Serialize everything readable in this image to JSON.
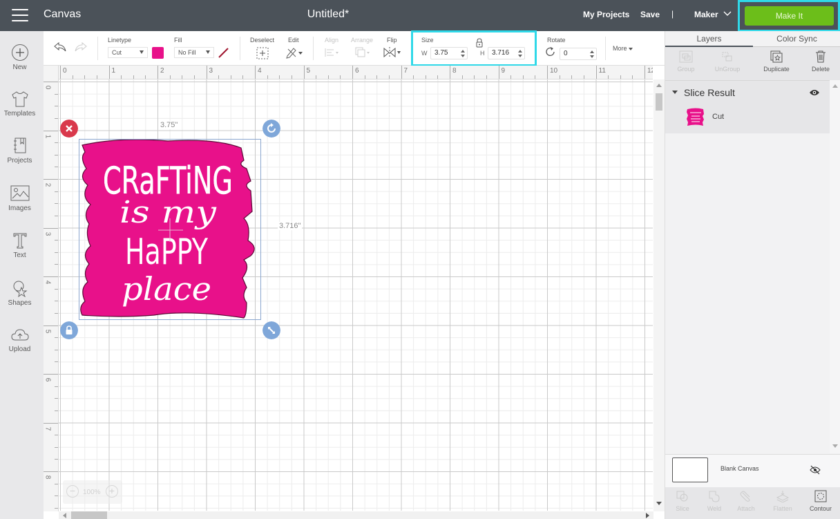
{
  "header": {
    "app_title": "Canvas",
    "document_title": "Untitled*",
    "my_projects": "My Projects",
    "save": "Save",
    "separator": "|",
    "machine": "Maker",
    "make_it": "Make It"
  },
  "sidebar": {
    "items": [
      {
        "label": "New",
        "icon": "plus-circle-icon"
      },
      {
        "label": "Templates",
        "icon": "tshirt-icon"
      },
      {
        "label": "Projects",
        "icon": "notebook-icon"
      },
      {
        "label": "Images",
        "icon": "image-icon"
      },
      {
        "label": "Text",
        "icon": "text-t-icon"
      },
      {
        "label": "Shapes",
        "icon": "shapes-icon"
      },
      {
        "label": "Upload",
        "icon": "cloud-upload-icon"
      }
    ]
  },
  "toolbar": {
    "linetype_label": "Linetype",
    "linetype_value": "Cut",
    "linetype_color": "#e8118a",
    "fill_label": "Fill",
    "fill_value": "No Fill",
    "deselect_label": "Deselect",
    "edit_label": "Edit",
    "align_label": "Align",
    "arrange_label": "Arrange",
    "flip_label": "Flip",
    "size_label": "Size",
    "width_label": "W",
    "width_value": "3.75",
    "height_label": "H",
    "height_value": "3.716",
    "rotate_label": "Rotate",
    "rotate_value": "0",
    "more_label": "More"
  },
  "canvas": {
    "ruler_x": [
      "0",
      "1",
      "2",
      "3",
      "4",
      "5",
      "6",
      "7",
      "8",
      "9",
      "10",
      "11",
      "12"
    ],
    "ruler_y": [
      "0",
      "1",
      "2",
      "3",
      "4",
      "5",
      "6",
      "7",
      "8"
    ],
    "selection_width_label": "3.75\"",
    "selection_height_label": "3.716\"",
    "design_text": [
      "CRaFTiNG",
      "is my",
      "HaPPY",
      "place"
    ],
    "design_color": "#e8118a",
    "zoom_level": "100%"
  },
  "layers_panel": {
    "tabs": [
      "Layers",
      "Color Sync"
    ],
    "active_tab": "Layers",
    "tools": [
      {
        "label": "Group",
        "enabled": false
      },
      {
        "label": "UnGroup",
        "enabled": false
      },
      {
        "label": "Duplicate",
        "enabled": true
      },
      {
        "label": "Delete",
        "enabled": true
      }
    ],
    "group_name": "Slice Result",
    "layer_name": "Cut",
    "blank_canvas": "Blank Canvas",
    "bottom_tools": [
      {
        "label": "Slice",
        "enabled": false
      },
      {
        "label": "Weld",
        "enabled": false
      },
      {
        "label": "Attach",
        "enabled": false
      },
      {
        "label": "Flatten",
        "enabled": false
      },
      {
        "label": "Contour",
        "enabled": true
      }
    ]
  },
  "colors": {
    "topbar": "#4b5259",
    "make_it_green": "#6cbe1a",
    "highlight_cyan": "#2fd8e8",
    "delete_handle": "#d9394c",
    "handle_blue": "#7fa7d9"
  }
}
